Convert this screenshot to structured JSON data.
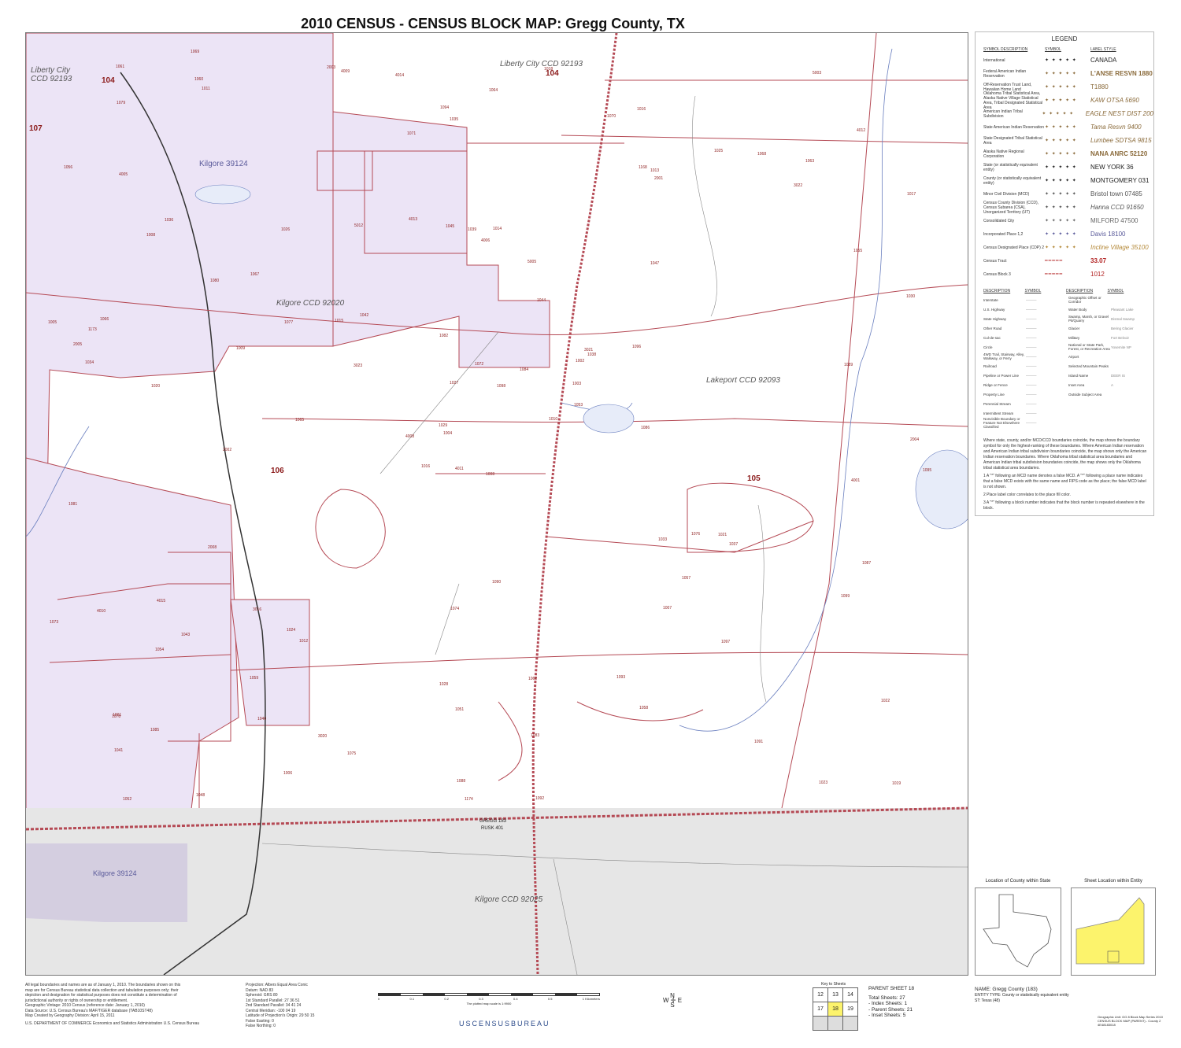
{
  "title": "2010 CENSUS - CENSUS BLOCK MAP:  Gregg County, TX",
  "map": {
    "ccd_labels": [
      "Liberty City CCD 92193",
      "Liberty City CCD 92193",
      "Kilgore CCD 92020",
      "Lakeport CCD 92093",
      "Kilgore CCD 92025"
    ],
    "tracts": [
      "104",
      "104",
      "107",
      "106",
      "105"
    ],
    "places": [
      "Kilgore 39124",
      "Kilgore 39124"
    ],
    "county_line_top": "GREGG 183",
    "county_line_bottom": "RUSK 401",
    "block_numbers": [
      "1008",
      "1008",
      "1004",
      "1001",
      "1002",
      "1012",
      "1016",
      "1014",
      "1013",
      "1010",
      "1011",
      "1019",
      "1020",
      "1017",
      "1016",
      "1047",
      "1048",
      "1045",
      "1044",
      "1043",
      "1042",
      "1041",
      "1040",
      "1039",
      "1038",
      "1037",
      "1036",
      "1035",
      "1034",
      "1033",
      "1030",
      "1029",
      "1028",
      "1027",
      "1026",
      "1025",
      "1024",
      "1023",
      "1022",
      "1021",
      "1018",
      "1015",
      "1009",
      "1007",
      "1006",
      "1005",
      "1003",
      "1052",
      "1051",
      "1053",
      "1054",
      "1055",
      "1056",
      "1057",
      "1058",
      "1059",
      "1060",
      "1061",
      "1062",
      "1063",
      "1064",
      "1065",
      "1066",
      "1067",
      "1068",
      "1069",
      "1070",
      "1071",
      "1072",
      "1073",
      "1074",
      "1075",
      "1076",
      "1077",
      "1078",
      "1079",
      "1080",
      "1081",
      "1082",
      "1083",
      "1084",
      "1085",
      "1086",
      "1087",
      "1088",
      "1089",
      "1090",
      "1091",
      "1092",
      "1093",
      "1094",
      "1095",
      "1096",
      "1097",
      "1098",
      "1099",
      "1173",
      "1174",
      "1168",
      "2001",
      "2002",
      "2003",
      "2004",
      "2005",
      "2008",
      "3016",
      "3020",
      "3021",
      "3022",
      "3023",
      "4001",
      "4005",
      "4006",
      "4008",
      "4009",
      "4010",
      "4011",
      "4012",
      "4013",
      "4014",
      "4015",
      "5003",
      "5005",
      "5012"
    ]
  },
  "legend": {
    "title": "LEGEND",
    "col_headers": [
      "SYMBOL DESCRIPTION",
      "SYMBOL",
      "LABEL STYLE"
    ],
    "rows": [
      {
        "desc": "International",
        "label": "CANADA",
        "color": "#222222"
      },
      {
        "desc": "Federal American Indian Reservation",
        "label": "L'ANSE RESVN 1880",
        "color": "#8a6a3a"
      },
      {
        "desc": "Off-Reservation Trust Land, Hawaiian Home Land",
        "label": "T1880",
        "color": "#8a6a3a"
      },
      {
        "desc": "Oklahoma Tribal Statistical Area, Alaska Native Village Statistical Area, Tribal Designated Statistical Area",
        "label": "KAW OTSA 5690",
        "color": "#8a6a3a"
      },
      {
        "desc": "American Indian Tribal Subdivision",
        "label": "EAGLE NEST DIST 200",
        "color": "#8a6a3a"
      },
      {
        "desc": "State American Indian Reservation",
        "label": "Tama Resvn 9400",
        "color": "#8a6a3a"
      },
      {
        "desc": "State Designated Tribal Statistical Area",
        "label": "Lumbee SDTSA 9815",
        "color": "#8a6a3a"
      },
      {
        "desc": "Alaska Native Regional Corporation",
        "label": "NANA ANRC 52120",
        "color": "#8a6a3a"
      },
      {
        "desc": "State (or statistically equivalent entity)",
        "label": "NEW YORK 36",
        "color": "#222222"
      },
      {
        "desc": "County (or statistically equivalent entity)",
        "label": "MONTGOMERY 031",
        "color": "#222222"
      },
      {
        "desc": "Minor Civil Division (MCD)",
        "label": "Bristol town 07485",
        "color": "#555555"
      },
      {
        "desc": "Census County Division (CCD), Census Subarea (CSA), Unorganized Territory (UT)",
        "label": "Hanna CCD 91650",
        "color": "#555555"
      },
      {
        "desc": "Consolidated City",
        "label": "MILFORD 47500",
        "color": "#666666"
      },
      {
        "desc": "Incorporated Place 1,2",
        "label": "Davis 18100",
        "color": "#5a5a9a"
      },
      {
        "desc": "Census Designated Place (CDP) 2",
        "label": "Incline Village 35100",
        "color": "#b58a3a"
      },
      {
        "desc": "Census Tract",
        "label": "33.07",
        "color": "#b22222"
      },
      {
        "desc": "Census Block 3",
        "label": "1012",
        "color": "#b22222"
      }
    ],
    "col_headers2": [
      "DESCRIPTION",
      "SYMBOL",
      "DESCRIPTION",
      "SYMBOL"
    ],
    "features_left": [
      "Interstate",
      "U.S. Highway",
      "State Highway",
      "Other Road",
      "Cul-de-sac",
      "Circle",
      "4WD Trail, Stairway, Alley, Walkway, or Ferry",
      "Railroad",
      "Pipeline or Power Line",
      "Ridge or Fence",
      "Property Line",
      "Perennial Stream",
      "Intermittent Stream",
      "Nonvisible Boundary or Feature Not Elsewhere Classified"
    ],
    "features_right": [
      "Geographic Offset or Corridor",
      "Water Body",
      "Swamp, Marsh, or Gravel Pit/Quarry",
      "Glacier",
      "Military",
      "National or State Park, Forest, or Recreation Area",
      "Airport",
      "Selected Mountain Peaks",
      "Island Name",
      "Inset Area",
      "Outside Subject Area"
    ],
    "feature_symbols": [
      "Pleasant Lake",
      "Dismal Swamp",
      "Bering Glacier",
      "Fort Belvoir",
      "Yosemite NP",
      "DEER IS",
      "A"
    ],
    "notes": [
      "Where state, county, and/or MCD/CCD boundaries coincide, the map shows the boundary symbol for only the highest-ranking of these boundaries. Where American Indian reservation and American Indian tribal subdivision boundaries coincide, the map shows only the American Indian reservation boundaries. Where Oklahoma tribal statistical area boundaries and American Indian tribal subdivision boundaries coincide, the map shows only the Oklahoma tribal statistical area boundaries.",
      "1  A \"*\" following an MCD name denotes a false MCD. A \"*\" following a place name indicates that a false MCD exists with the same name and FIPS code as the place; the false MCD label is not shown.",
      "2  Place label color correlates to the place fill color.",
      "3  A \"*\" following a block number indicates that the block number is repeated elsewhere in the block."
    ]
  },
  "insets": {
    "left_title": "Location of County within State",
    "right_title": "Sheet Location within Entity",
    "right_fill": "#fcf36c"
  },
  "footer": {
    "left_lines": [
      "All legal boundaries and names are as of January 1, 2010. The boundaries shown on this",
      "map are for Census Bureau statistical data collection and tabulation purposes only; their",
      "depiction and designation for statistical purposes does not constitute a determination of",
      "jurisdictional authority or rights of ownership or entitlement.",
      "Geographic Vintage: 2010 Census (reference date: January 1, 2010)",
      "Data Source: U.S. Census Bureau's MAF/TIGER database (TAB10ST48)",
      "Map Created by Geography Division: April 15, 2011"
    ],
    "agency": "U.S. DEPARTMENT OF COMMERCE Economics and Statistics Administration U.S. Census Bureau",
    "projection_lines": [
      "Projection: Albers Equal Area Conic",
      "Datum: NAD 83",
      "Spheroid: GRS 80",
      "1st Standard Parallel: 27 36 51",
      "2nd Standard Parallel: 34 41 24",
      "Central Meridian: -100 04 19",
      "Latitude of Projection's Origin: 29 50 15",
      "False Easting: 0",
      "False Northing: 0"
    ],
    "scale_note": "The plotted map scale is 1:9900",
    "scale_ticks": [
      "0",
      "0.1",
      "0.2",
      "0.3",
      "0.4",
      "0.5",
      "1 Kilometers"
    ],
    "key_title": "Key to Sheets",
    "key_grid": [
      [
        "12",
        "13",
        "14"
      ],
      [
        "17",
        "18",
        "19"
      ],
      [
        "",
        "",
        ""
      ]
    ],
    "parent_sheet": "PARENT SHEET 18",
    "sheet_counts": [
      "Total Sheets: 27",
      "- Index Sheets: 1",
      "- Parent Sheets: 21",
      "- Inset Sheets: 5"
    ],
    "entity_name": "NAME: Gregg County (183)",
    "entity_type": "ENTITY TYPE: County or statistically equivalent entity",
    "entity_state": "ST: Texas (48)",
    "bureau": "USCENSUSBUREAU",
    "series": "Geographic Unit: GG 8 Block Map Series 2010 CENSUS BLOCK MAP (PARENT) - County 2 4E48183018"
  },
  "colors": {
    "place_fill": "#ece4f6",
    "block_line": "#b54a55",
    "outside_area": "#e6e6e6",
    "tract_label": "#8b1a1a"
  }
}
